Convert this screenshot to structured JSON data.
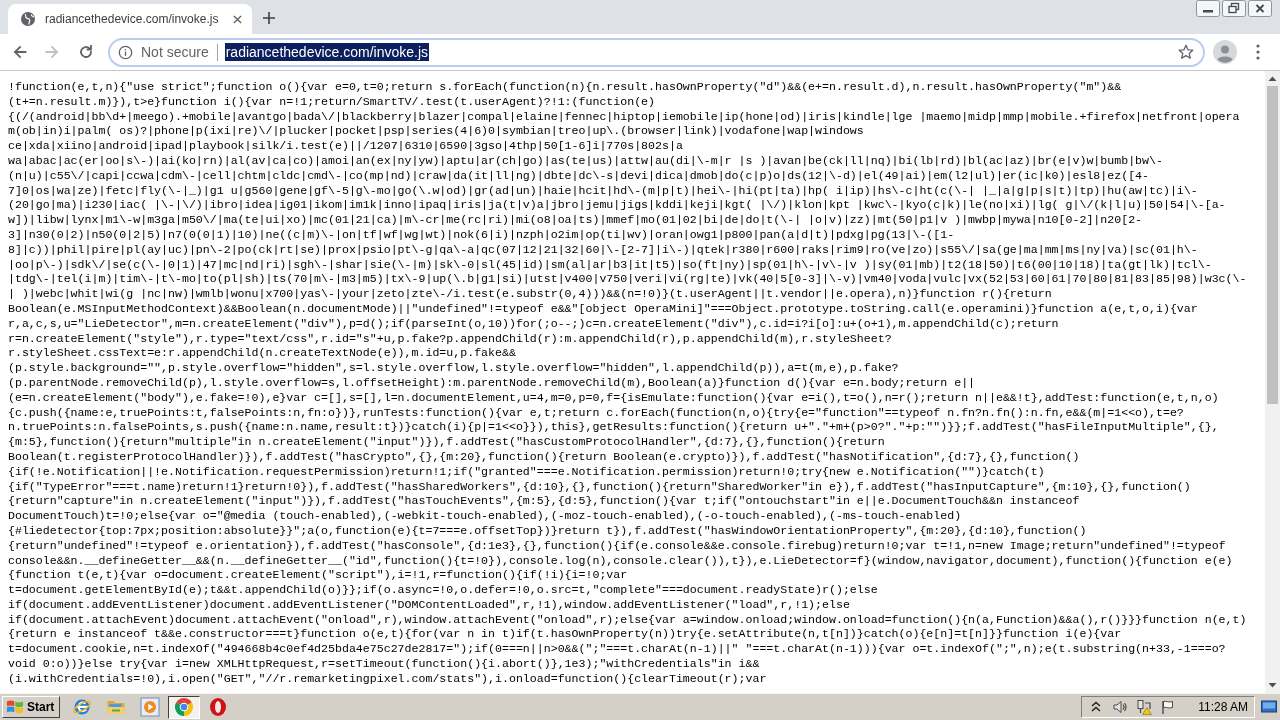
{
  "browser": {
    "tabs": [
      {
        "title": "radiancethedevice.com/invoke.js",
        "selected": true
      }
    ],
    "nav_buttons": [
      {
        "kind": "back",
        "disabled": false
      },
      {
        "kind": "forward",
        "disabled": true
      },
      {
        "kind": "reload",
        "disabled": false
      }
    ],
    "address_bar": {
      "security_label": "Not secure",
      "url": "radiancethedevice.com/invoke.js",
      "url_selected": true
    }
  },
  "document": {
    "lines": [
      "!function(e,t,n){\"use strict\";function o(){var e=0,t=0;return s.forEach(function(n){n.result.hasOwnProperty(\"d\")&&(e+=n.result.d),n.result.hasOwnProperty(\"m\")&&",
      "(t+=n.result.m)}),t>e}function i(){var n=!1;return/SmartTV/.test(t.userAgent)?!1:(function(e)",
      "{(/(android|bb\\d+|meego).+mobile|avantgo|bada\\/|blackberry|blazer|compal|elaine|fennec|hiptop|iemobile|ip(hone|od)|iris|kindle|lge |maemo|midp|mmp|mobile.+firefox|netfront|opera",
      "m(ob|in)i|palm( os)?|phone|p(ixi|re)\\/|plucker|pocket|psp|series(4|6)0|symbian|treo|up\\.(browser|link)|vodafone|wap|windows",
      "ce|xda|xiino|android|ipad|playbook|silk/i.test(e)||/1207|6310|6590|3gso|4thp|50[1-6]i|770s|802s|a",
      "wa|abac|ac(er|oo|s\\-)|ai(ko|rn)|al(av|ca|co)|amoi|an(ex|ny|yw)|aptu|ar(ch|go)|as(te|us)|attw|au(di|\\-m|r |s )|avan|be(ck|ll|nq)|bi(lb|rd)|bl(ac|az)|br(e|v)w|bumb|bw\\-",
      "(n|u)|c55\\/|capi|ccwa|cdm\\-|cell|chtm|cldc|cmd\\-|co(mp|nd)|craw|da(it|ll|ng)|dbte|dc\\-s|devi|dica|dmob|do(c|p)o|ds(12|\\-d)|el(49|ai)|em(l2|ul)|er(ic|k0)|esl8|ez([4-",
      "7]0|os|wa|ze)|fetc|fly(\\-|_)|g1 u|g560|gene|gf\\-5|g\\-mo|go(\\.w|od)|gr(ad|un)|haie|hcit|hd\\-(m|p|t)|hei\\-|hi(pt|ta)|hp( i|ip)|hs\\-c|ht(c(\\-| |_|a|g|p|s|t)|tp)|hu(aw|tc)|i\\-",
      "(20|go|ma)|i230|iac( |\\-|\\/)|ibro|idea|ig01|ikom|im1k|inno|ipaq|iris|ja(t|v)a|jbro|jemu|jigs|kddi|keji|kgt( |\\/)|klon|kpt |kwc\\-|kyo(c|k)|le(no|xi)|lg( g|\\/(k|l|u)|50|54|\\-[a-",
      "w])|libw|lynx|m1\\-w|m3ga|m50\\/|ma(te|ui|xo)|mc(01|21|ca)|m\\-cr|me(rc|ri)|mi(o8|oa|ts)|mmef|mo(01|02|bi|de|do|t(\\-| |o|v)|zz)|mt(50|p1|v )|mwbp|mywa|n10[0-2]|n20[2-",
      "3]|n30(0|2)|n50(0|2|5)|n7(0(0|1)|10)|ne((c|m)\\-|on|tf|wf|wg|wt)|nok(6|i)|nzph|o2im|op(ti|wv)|oran|owg1|p800|pan(a|d|t)|pdxg|pg(13|\\-([1-",
      "8]|c))|phil|pire|pl(ay|uc)|pn\\-2|po(ck|rt|se)|prox|psio|pt\\-g|qa\\-a|qc(07|12|21|32|60|\\-[2-7]|i\\-)|qtek|r380|r600|raks|rim9|ro(ve|zo)|s55\\/|sa(ge|ma|mm|ms|ny|va)|sc(01|h\\-",
      "|oo|p\\-)|sdk\\/|se(c(\\-|0|1)|47|mc|nd|ri)|sgh\\-|shar|sie(\\-|m)|sk\\-0|sl(45|id)|sm(al|ar|b3|it|t5)|so(ft|ny)|sp(01|h\\-|v\\-|v )|sy(01|mb)|t2(18|50)|t6(00|10|18)|ta(gt|lk)|tcl\\-",
      "|tdg\\-|tel(i|m)|tim\\-|t\\-mo|to(pl|sh)|ts(70|m\\-|m3|m5)|tx\\-9|up(\\.b|g1|si)|utst|v400|v750|veri|vi(rg|te)|vk(40|5[0-3]|\\-v)|vm40|voda|vulc|vx(52|53|60|61|70|80|81|83|85|98)|w3c(\\-",
      "| )|webc|whit|wi(g |nc|nw)|wmlb|wonu|x700|yas\\-|your|zeto|zte\\-/i.test(e.substr(0,4)))&&(n=!0)}(t.userAgent||t.vendor||e.opera),n)}function r(){return",
      "Boolean(e.MSInputMethodContext)&&Boolean(n.documentMode)||\"undefined\"!=typeof e&&\"[object OperaMini]\"===Object.prototype.toString.call(e.operamini)}function a(e,t,o,i){var",
      "r,a,c,s,u=\"LieDetector\",m=n.createElement(\"div\"),p=d();if(parseInt(o,10))for(;o--;)c=n.createElement(\"div\"),c.id=i?i[o]:u+(o+1),m.appendChild(c);return",
      "r=n.createElement(\"style\"),r.type=\"text/css\",r.id=\"s\"+u,p.fake?p.appendChild(r):m.appendChild(r),p.appendChild(m),r.styleSheet?",
      "r.styleSheet.cssText=e:r.appendChild(n.createTextNode(e)),m.id=u,p.fake&&",
      "(p.style.background=\"\",p.style.overflow=\"hidden\",s=l.style.overflow,l.style.overflow=\"hidden\",l.appendChild(p)),a=t(m,e),p.fake?",
      "(p.parentNode.removeChild(p),l.style.overflow=s,l.offsetHeight):m.parentNode.removeChild(m),Boolean(a)}function d(){var e=n.body;return e||",
      "(e=n.createElement(\"body\"),e.fake=!0),e}var c=[],s=[],l=n.documentElement,u=4,m=0,p=0,f={isEmulate:function(){var e=i(),t=o(),n=r();return n||e&&!t},addTest:function(e,t,n,o)",
      "{c.push({name:e,truePoints:t,falsePoints:n,fn:o})},runTests:function(){var e,t;return c.forEach(function(n,o){try{e=\"function\"==typeof n.fn?n.fn():n.fn,e&&(m|=1<<o),t=e?",
      "n.truePoints:n.falsePoints,s.push({name:n.name,result:t})}catch(i){p|=1<<o}}),this},getResults:function(){return u+\".\"+m+(p>0?\".\"+p:\"\")}};f.addTest(\"hasFileInputMultiple\",{},",
      "{m:5},function(){return\"multiple\"in n.createElement(\"input\")}),f.addTest(\"hasCustomProtocolHandler\",{d:7},{},function(){return",
      "Boolean(t.registerProtocolHandler)}),f.addTest(\"hasCrypto\",{},{m:20},function(){return Boolean(e.crypto)}),f.addTest(\"hasNotification\",{d:7},{},function()",
      "{if(!e.Notification||!e.Notification.requestPermission)return!1;if(\"granted\"===e.Notification.permission)return!0;try{new e.Notification(\"\")}catch(t)",
      "{if(\"TypeError\"===t.name)return!1}return!0}),f.addTest(\"hasSharedWorkers\",{d:10},{},function(){return\"SharedWorker\"in e}),f.addTest(\"hasInputCapture\",{m:10},{},function()",
      "{return\"capture\"in n.createElement(\"input\")}),f.addTest(\"hasTouchEvents\",{m:5},{d:5},function(){var t;if(\"ontouchstart\"in e||e.DocumentTouch&&n instanceof",
      "DocumentTouch)t=!0;else{var o=\"@media (touch-enabled),(-webkit-touch-enabled),(-moz-touch-enabled),(-o-touch-enabled),(-ms-touch-enabled)",
      "{#liedetector{top:7px;position:absolute}}\";a(o,function(e){t=7===e.offsetTop})}return t}),f.addTest(\"hasWindowOrientationProperty\",{m:20},{d:10},function()",
      "{return\"undefined\"!=typeof e.orientation}),f.addTest(\"hasConsole\",{d:1e3},{},function(){if(e.console&&e.console.firebug)return!0;var t=!1,n=new Image;return\"undefined\"!=typeof",
      "console&&n.__defineGetter__&&(n.__defineGetter__(\"id\",function(){t=!0}),console.log(n),console.clear()),t}),e.LieDetector=f}(window,navigator,document),function(){function e(e)",
      "{function t(e,t){var o=document.createElement(\"script\"),i=!1,r=function(){if(!i){i=!0;var",
      "t=document.getElementById(e);t&&t.appendChild(o)}};if(o.async=!0,o.defer=!0,o.src=t,\"complete\"===document.readyState)r();else",
      "if(document.addEventListener)document.addEventListener(\"DOMContentLoaded\",r,!1),window.addEventListener(\"load\",r,!1);else",
      "if(document.attachEvent)document.attachEvent(\"onload\",r),window.attachEvent(\"onload\",r);else{var a=window.onload;window.onload=function(){n(a,Function)&&a(),r()}}}function n(e,t)",
      "{return e instanceof t&&e.constructor===t}function o(e,t){for(var n in t)if(t.hasOwnProperty(n))try{e.setAttribute(n,t[n])}catch(o){e[n]=t[n]}}function i(e){var",
      "t=document.cookie,n=t.indexOf(\"494668b4c0ef4d25bda4e75c27de2817=\");if(0===n||n>0&&(\";\"===t.charAt(n-1)||\" \"===t.charAt(n-1))){var o=t.indexOf(\";\",n);e(t.substring(n+33,-1===o?",
      "void 0:o))}else try{var i=new XMLHttpRequest,r=setTimeout(function(){i.abort()},1e3);\"withCredentials\"in i&&",
      "(i.withCredentials=!0),i.open(\"GET\",\"//r.remarketingpixel.com/stats\"),i.onload=function(){clearTimeout(r);var"
    ]
  },
  "taskbar": {
    "start_label": "Start",
    "apps": [
      {
        "kind": "ie",
        "selected": false
      },
      {
        "kind": "explorer",
        "selected": false
      },
      {
        "kind": "media_player",
        "selected": false
      },
      {
        "kind": "chrome",
        "selected": true
      },
      {
        "kind": "app",
        "selected": false
      }
    ],
    "clock": "11:28 AM"
  }
}
